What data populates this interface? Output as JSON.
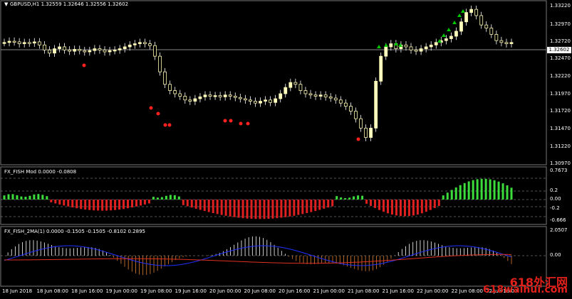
{
  "main_panel": {
    "title": "GBPUSD,H1  1.32559 1.32646 1.32556 1.32602",
    "price_axis": [
      "1.33220",
      "1.32970",
      "1.32720",
      "1.32470",
      "1.32220",
      "1.31970",
      "1.31720",
      "1.31470",
      "1.31220",
      "1.30970"
    ],
    "current_price": "1.32602"
  },
  "indicator1": {
    "title": "FX_FISH Mod 0.0000 -0.0808",
    "axis": [
      "0.7673",
      "0.2",
      "0.00",
      "-0.2",
      "-0.666"
    ]
  },
  "indicator2": {
    "title": "FX_FISH_2MA(1) 0.0000 -0.1505 -0.1505 -0.8102 0.2895",
    "axis": [
      "2.0507",
      "0.00"
    ]
  },
  "time_axis": [
    "18 Jun 2018",
    "18 Jun 08:00",
    "18 Jun 16:00",
    "19 Jun 00:00",
    "19 Jun 08:00",
    "19 Jun 16:00",
    "20 Jun 00:00",
    "20 Jun 08:00",
    "20 Jun 16:00",
    "21 Jun 00:00",
    "21 Jun 08:00",
    "21 Jun 16:00",
    "22 Jun 00:00",
    "22 Jun 08:00",
    "22 Jun 16:00"
  ],
  "watermark": {
    "line1": "618外汇网",
    "line2": "618waihui.com"
  },
  "colors": {
    "bull": "#ffffc0",
    "bear": "#fff8b0",
    "up_arrow": "#00c800",
    "down_arrow": "#ff2020",
    "fish_pos": "#3cdc3c",
    "fish_neg": "#e02020",
    "ma_blue": "#2030ff",
    "ma_red": "#e03020",
    "hist": "#ffffff",
    "hist_neg": "#e08030"
  }
}
